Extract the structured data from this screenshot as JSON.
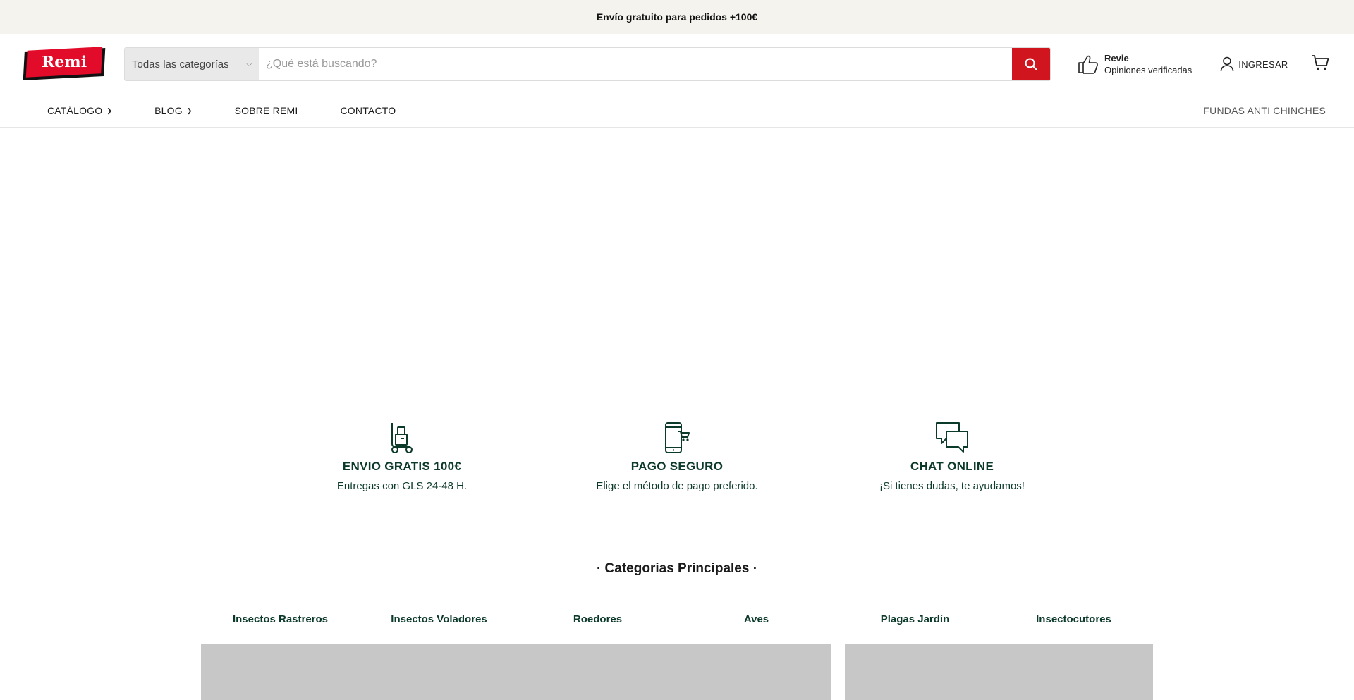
{
  "announcement": "Envío gratuito para pedidos +100€",
  "logo": {
    "text": "Remi"
  },
  "search": {
    "category": "Todas las categorías",
    "placeholder": "¿Qué está buscando?"
  },
  "revie": {
    "title": "Revie",
    "subtitle": "Opiniones verificadas",
    "icon": "thumbs-up-icon"
  },
  "account": {
    "label": "INGRESAR",
    "icon": "user-icon"
  },
  "cart": {
    "icon": "cart-icon"
  },
  "nav": {
    "items": [
      {
        "label": "CATÁLOGO",
        "dropdown": true
      },
      {
        "label": "BLOG",
        "dropdown": true
      },
      {
        "label": "SOBRE REMI",
        "dropdown": false
      },
      {
        "label": "CONTACTO",
        "dropdown": false
      }
    ],
    "right": "FUNDAS ANTI CHINCHES"
  },
  "features": [
    {
      "icon": "delivery-trolley-icon",
      "title": "ENVIO GRATIS 100€",
      "subtitle": "Entregas con GLS 24-48 H."
    },
    {
      "icon": "mobile-cart-icon",
      "title": "PAGO SEGURO",
      "subtitle": "Elige el método de pago preferido."
    },
    {
      "icon": "chat-bubbles-icon",
      "title": "CHAT ONLINE",
      "subtitle": "¡Si tienes dudas, te ayudamos!"
    }
  ],
  "categories": {
    "title": "· Categorias Principales ·",
    "items": [
      "Insectos Rastreros",
      "Insectos Voladores",
      "Roedores",
      "Aves",
      "Plagas Jardín",
      "Insectocutores"
    ]
  },
  "colors": {
    "accent": "#d1151f",
    "brand": "#e30b2a",
    "text_green": "#0c3a2a",
    "announce_bg": "#f4f3ee"
  }
}
